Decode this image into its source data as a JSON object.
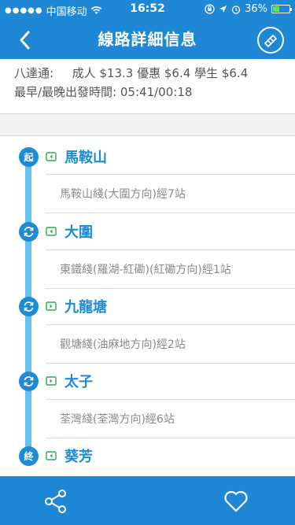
{
  "status_bar": {
    "carrier": "中国移动",
    "time": "16:52",
    "battery": "36%"
  },
  "nav": {
    "title": "線路詳細信息"
  },
  "fare": {
    "octopus_label": "八達通:",
    "adult": "成人 $13.3",
    "concession": "優惠 $6.4",
    "student": "學生 $6.4",
    "times_label": "最早/最晚出發時間:",
    "times": "05:41/00:18"
  },
  "route": {
    "stations": [
      {
        "badge": "起",
        "name": "馬鞍山",
        "direction": "right"
      },
      {
        "badge": "",
        "name": "大圍",
        "direction": "right"
      },
      {
        "badge": "",
        "name": "九龍塘",
        "direction": "left"
      },
      {
        "badge": "",
        "name": "太子",
        "direction": "left"
      },
      {
        "badge": "終",
        "name": "葵芳",
        "direction": "right"
      }
    ],
    "legs": [
      "馬鞍山綫(大圍方向)經7站",
      "東鐵綫(羅湖-紅磡)(紅磡方向)經1站",
      "觀塘綫(油麻地方向)經2站",
      "荃灣綫(荃灣方向)經6站"
    ]
  },
  "colors": {
    "accent": "#1e88d6",
    "track": "#66c1ee",
    "station_text": "#1e8bd4",
    "direction_icon": "#2fa84f"
  }
}
